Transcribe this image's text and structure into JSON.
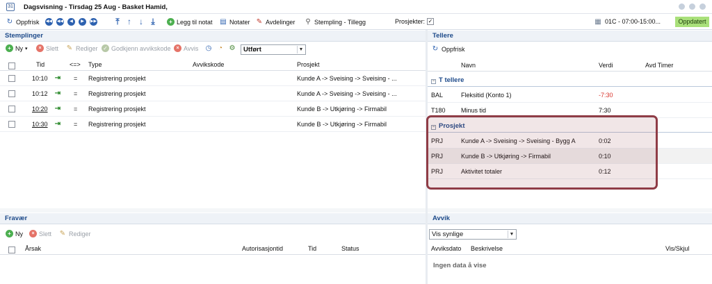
{
  "window": {
    "title": "Dagsvisning - Tirsdag 25 Aug - Basket Hamid,"
  },
  "toolbar": {
    "refresh_label": "Oppfrisk",
    "add_note_label": "Legg til notat",
    "notes_label": "Notater",
    "departments_label": "Avdelinger",
    "stamping_label": "Stempling - Tillegg",
    "projects_label": "Prosjekter:",
    "projects_checked": true,
    "status_text": "01C - 07:00-15:00...",
    "updated_label": "Oppdatert",
    "updated_color": "#a9e07a"
  },
  "stamps": {
    "header": "Stemplinger",
    "toolbar": {
      "new_label": "Ny",
      "delete_label": "Slett",
      "edit_label": "Rediger",
      "approve_label": "Godkjenn avvikskode",
      "reject_label": "Avvis",
      "filter_value": "Utført"
    },
    "columns": {
      "time": "Tid",
      "dir": "<=>",
      "type": "Type",
      "deviation": "Avvikskode",
      "project": "Prosjekt"
    },
    "rows": [
      {
        "time": "10:10",
        "dir": "=",
        "type": "Registrering prosjekt",
        "deviation": "",
        "project": "Kunde A -> Sveising -> Sveising - ..."
      },
      {
        "time": "10:12",
        "dir": "=",
        "type": "Registrering prosjekt",
        "deviation": "",
        "project": "Kunde A -> Sveising -> Sveising - ..."
      },
      {
        "time": "10:20",
        "dir": "=",
        "type": "Registrering prosjekt",
        "deviation": "",
        "project": "Kunde B -> Utkjøring -> Firmabil"
      },
      {
        "time": "10:30",
        "dir": "=",
        "type": "Registrering prosjekt",
        "deviation": "",
        "project": "Kunde B -> Utkjøring -> Firmabil"
      }
    ]
  },
  "counters": {
    "header": "Tellere",
    "refresh_label": "Oppfrisk",
    "columns": {
      "name": "Navn",
      "value": "Verdi",
      "prev": "Avd Timer"
    },
    "groups": [
      {
        "name": "T tellere",
        "rows": [
          {
            "code": "BAL",
            "name": "Fleksitid (Konto 1)",
            "value": "-7:30",
            "negative": true
          },
          {
            "code": "T180",
            "name": "Minus tid",
            "value": "7:30",
            "negative": false
          }
        ]
      },
      {
        "name": "Prosjekt",
        "rows": [
          {
            "code": "PRJ",
            "name": "Kunde A -> Sveising -> Sveising - Bygg A",
            "value": "0:02",
            "negative": false
          },
          {
            "code": "PRJ",
            "name": "Kunde B -> Utkjøring -> Firmabil",
            "value": "0:10",
            "negative": false
          },
          {
            "code": "PRJ",
            "name": "Aktivitet totaler",
            "value": "0:12",
            "negative": false
          }
        ]
      }
    ],
    "negative_color": "#d9342b"
  },
  "absence": {
    "header": "Fravær",
    "toolbar": {
      "new_label": "Ny",
      "delete_label": "Slett",
      "edit_label": "Rediger"
    },
    "columns": {
      "cause": "Årsak",
      "auth": "Autorisasjontid",
      "time": "Tid",
      "status": "Status"
    }
  },
  "deviations": {
    "header": "Avvik",
    "filter_value": "Vis synlige",
    "columns": {
      "date": "Avviksdato",
      "desc": "Beskrivelse",
      "show": "Vis/Skjul"
    },
    "empty_text": "Ingen data å vise"
  }
}
